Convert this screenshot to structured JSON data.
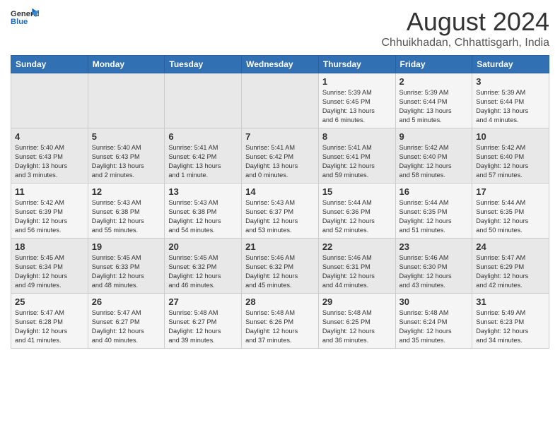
{
  "header": {
    "logo_general": "General",
    "logo_blue": "Blue",
    "month_title": "August 2024",
    "location": "Chhuikhadan, Chhattisgarh, India"
  },
  "days_of_week": [
    "Sunday",
    "Monday",
    "Tuesday",
    "Wednesday",
    "Thursday",
    "Friday",
    "Saturday"
  ],
  "weeks": [
    [
      {
        "day": "",
        "info": ""
      },
      {
        "day": "",
        "info": ""
      },
      {
        "day": "",
        "info": ""
      },
      {
        "day": "",
        "info": ""
      },
      {
        "day": "1",
        "info": "Sunrise: 5:39 AM\nSunset: 6:45 PM\nDaylight: 13 hours\nand 6 minutes."
      },
      {
        "day": "2",
        "info": "Sunrise: 5:39 AM\nSunset: 6:44 PM\nDaylight: 13 hours\nand 5 minutes."
      },
      {
        "day": "3",
        "info": "Sunrise: 5:39 AM\nSunset: 6:44 PM\nDaylight: 13 hours\nand 4 minutes."
      }
    ],
    [
      {
        "day": "4",
        "info": "Sunrise: 5:40 AM\nSunset: 6:43 PM\nDaylight: 13 hours\nand 3 minutes."
      },
      {
        "day": "5",
        "info": "Sunrise: 5:40 AM\nSunset: 6:43 PM\nDaylight: 13 hours\nand 2 minutes."
      },
      {
        "day": "6",
        "info": "Sunrise: 5:41 AM\nSunset: 6:42 PM\nDaylight: 13 hours\nand 1 minute."
      },
      {
        "day": "7",
        "info": "Sunrise: 5:41 AM\nSunset: 6:42 PM\nDaylight: 13 hours\nand 0 minutes."
      },
      {
        "day": "8",
        "info": "Sunrise: 5:41 AM\nSunset: 6:41 PM\nDaylight: 12 hours\nand 59 minutes."
      },
      {
        "day": "9",
        "info": "Sunrise: 5:42 AM\nSunset: 6:40 PM\nDaylight: 12 hours\nand 58 minutes."
      },
      {
        "day": "10",
        "info": "Sunrise: 5:42 AM\nSunset: 6:40 PM\nDaylight: 12 hours\nand 57 minutes."
      }
    ],
    [
      {
        "day": "11",
        "info": "Sunrise: 5:42 AM\nSunset: 6:39 PM\nDaylight: 12 hours\nand 56 minutes."
      },
      {
        "day": "12",
        "info": "Sunrise: 5:43 AM\nSunset: 6:38 PM\nDaylight: 12 hours\nand 55 minutes."
      },
      {
        "day": "13",
        "info": "Sunrise: 5:43 AM\nSunset: 6:38 PM\nDaylight: 12 hours\nand 54 minutes."
      },
      {
        "day": "14",
        "info": "Sunrise: 5:43 AM\nSunset: 6:37 PM\nDaylight: 12 hours\nand 53 minutes."
      },
      {
        "day": "15",
        "info": "Sunrise: 5:44 AM\nSunset: 6:36 PM\nDaylight: 12 hours\nand 52 minutes."
      },
      {
        "day": "16",
        "info": "Sunrise: 5:44 AM\nSunset: 6:35 PM\nDaylight: 12 hours\nand 51 minutes."
      },
      {
        "day": "17",
        "info": "Sunrise: 5:44 AM\nSunset: 6:35 PM\nDaylight: 12 hours\nand 50 minutes."
      }
    ],
    [
      {
        "day": "18",
        "info": "Sunrise: 5:45 AM\nSunset: 6:34 PM\nDaylight: 12 hours\nand 49 minutes."
      },
      {
        "day": "19",
        "info": "Sunrise: 5:45 AM\nSunset: 6:33 PM\nDaylight: 12 hours\nand 48 minutes."
      },
      {
        "day": "20",
        "info": "Sunrise: 5:45 AM\nSunset: 6:32 PM\nDaylight: 12 hours\nand 46 minutes."
      },
      {
        "day": "21",
        "info": "Sunrise: 5:46 AM\nSunset: 6:32 PM\nDaylight: 12 hours\nand 45 minutes."
      },
      {
        "day": "22",
        "info": "Sunrise: 5:46 AM\nSunset: 6:31 PM\nDaylight: 12 hours\nand 44 minutes."
      },
      {
        "day": "23",
        "info": "Sunrise: 5:46 AM\nSunset: 6:30 PM\nDaylight: 12 hours\nand 43 minutes."
      },
      {
        "day": "24",
        "info": "Sunrise: 5:47 AM\nSunset: 6:29 PM\nDaylight: 12 hours\nand 42 minutes."
      }
    ],
    [
      {
        "day": "25",
        "info": "Sunrise: 5:47 AM\nSunset: 6:28 PM\nDaylight: 12 hours\nand 41 minutes."
      },
      {
        "day": "26",
        "info": "Sunrise: 5:47 AM\nSunset: 6:27 PM\nDaylight: 12 hours\nand 40 minutes."
      },
      {
        "day": "27",
        "info": "Sunrise: 5:48 AM\nSunset: 6:27 PM\nDaylight: 12 hours\nand 39 minutes."
      },
      {
        "day": "28",
        "info": "Sunrise: 5:48 AM\nSunset: 6:26 PM\nDaylight: 12 hours\nand 37 minutes."
      },
      {
        "day": "29",
        "info": "Sunrise: 5:48 AM\nSunset: 6:25 PM\nDaylight: 12 hours\nand 36 minutes."
      },
      {
        "day": "30",
        "info": "Sunrise: 5:48 AM\nSunset: 6:24 PM\nDaylight: 12 hours\nand 35 minutes."
      },
      {
        "day": "31",
        "info": "Sunrise: 5:49 AM\nSunset: 6:23 PM\nDaylight: 12 hours\nand 34 minutes."
      }
    ]
  ]
}
